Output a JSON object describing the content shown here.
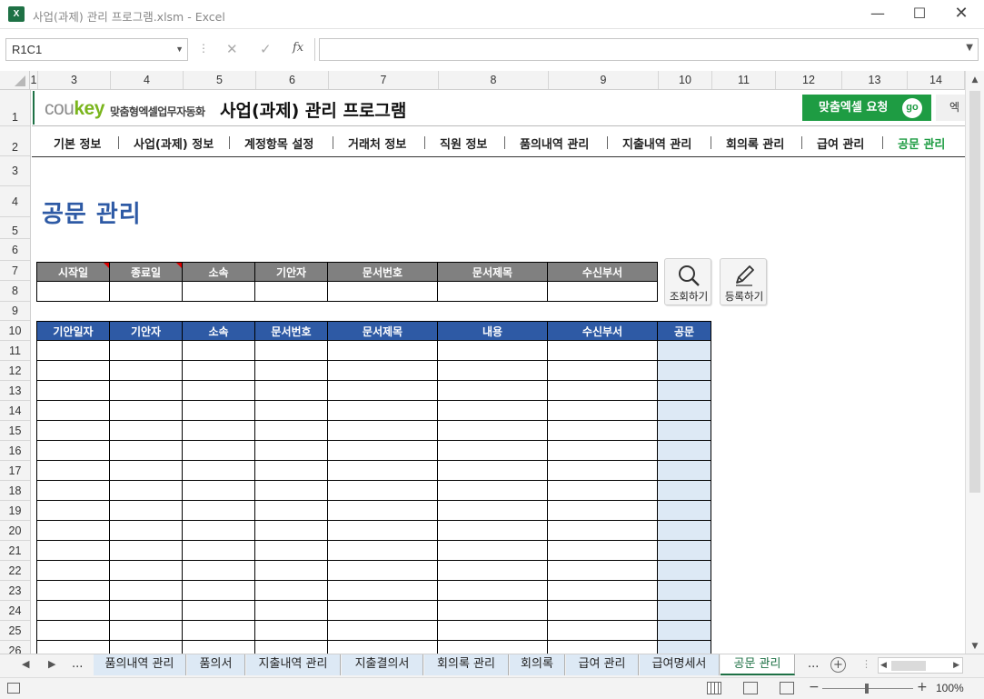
{
  "window": {
    "title": "사업(과제) 관리 프로그램.xlsm  -  Excel",
    "app_icon_label": "X"
  },
  "formula_bar": {
    "name_box": "R1C1",
    "formula": ""
  },
  "column_headers": [
    "1",
    "3",
    "4",
    "5",
    "6",
    "7",
    "8",
    "9",
    "10",
    "11",
    "12",
    "13",
    "14"
  ],
  "row_headers": [
    "1",
    "2",
    "3",
    "4",
    "5",
    "6",
    "7",
    "8",
    "9",
    "10",
    "11",
    "12",
    "13",
    "14",
    "15",
    "16",
    "17",
    "18",
    "19",
    "20",
    "21",
    "22",
    "23",
    "24",
    "25",
    "26"
  ],
  "banner": {
    "logo_prefix": "cou",
    "logo_accent": "key",
    "logo_sub": "맞춤형엑셀업무자동화",
    "program_title": "사업(과제) 관리 프로그램",
    "request_button": "맞춤엑셀 요청",
    "go_badge": "go",
    "extra_button": "엑"
  },
  "nav": {
    "items": [
      "기본 정보",
      "사업(과제) 정보",
      "계정항목 설정",
      "거래처 정보",
      "직원 정보",
      "품의내역 관리",
      "지출내역 관리",
      "회의록 관리",
      "급여 관리",
      "공문 관리"
    ],
    "active_color": "#1e9c43"
  },
  "page_title": "공문 관리",
  "search_form": {
    "headers": [
      "시작일",
      "종료일",
      "소속",
      "기안자",
      "문서번호",
      "문서제목",
      "수신부서"
    ],
    "values": [
      "",
      "",
      "",
      "",
      "",
      "",
      ""
    ]
  },
  "actions": {
    "search": "조회하기",
    "register": "등록하기"
  },
  "list_table": {
    "headers": [
      "기안일자",
      "기안자",
      "소속",
      "문서번호",
      "문서제목",
      "내용",
      "수신부서",
      "공문"
    ],
    "rows": [
      [
        "",
        "",
        "",
        "",
        "",
        "",
        "",
        ""
      ],
      [
        "",
        "",
        "",
        "",
        "",
        "",
        "",
        ""
      ],
      [
        "",
        "",
        "",
        "",
        "",
        "",
        "",
        ""
      ],
      [
        "",
        "",
        "",
        "",
        "",
        "",
        "",
        ""
      ],
      [
        "",
        "",
        "",
        "",
        "",
        "",
        "",
        ""
      ],
      [
        "",
        "",
        "",
        "",
        "",
        "",
        "",
        ""
      ],
      [
        "",
        "",
        "",
        "",
        "",
        "",
        "",
        ""
      ],
      [
        "",
        "",
        "",
        "",
        "",
        "",
        "",
        ""
      ],
      [
        "",
        "",
        "",
        "",
        "",
        "",
        "",
        ""
      ],
      [
        "",
        "",
        "",
        "",
        "",
        "",
        "",
        ""
      ],
      [
        "",
        "",
        "",
        "",
        "",
        "",
        "",
        ""
      ],
      [
        "",
        "",
        "",
        "",
        "",
        "",
        "",
        ""
      ],
      [
        "",
        "",
        "",
        "",
        "",
        "",
        "",
        ""
      ],
      [
        "",
        "",
        "",
        "",
        "",
        "",
        "",
        ""
      ],
      [
        "",
        "",
        "",
        "",
        "",
        "",
        "",
        ""
      ],
      [
        "",
        "",
        "",
        "",
        "",
        "",
        "",
        ""
      ]
    ]
  },
  "sheet_tabs": {
    "ellipsis_left": "...",
    "tabs": [
      "품의내역 관리",
      "품의서",
      "지출내역 관리",
      "지출결의서",
      "회의록 관리",
      "회의록",
      "급여 관리",
      "급여명세서",
      "공문 관리"
    ],
    "active": "공문 관리",
    "ellipsis_right": "..."
  },
  "status": {
    "zoom": "100%"
  },
  "colors": {
    "excel_green": "#1e7145",
    "header_gray": "#808080",
    "header_blue": "#2e5aa5",
    "doc_column": "#dde9f5",
    "tab_blue": "#dde9f5"
  }
}
